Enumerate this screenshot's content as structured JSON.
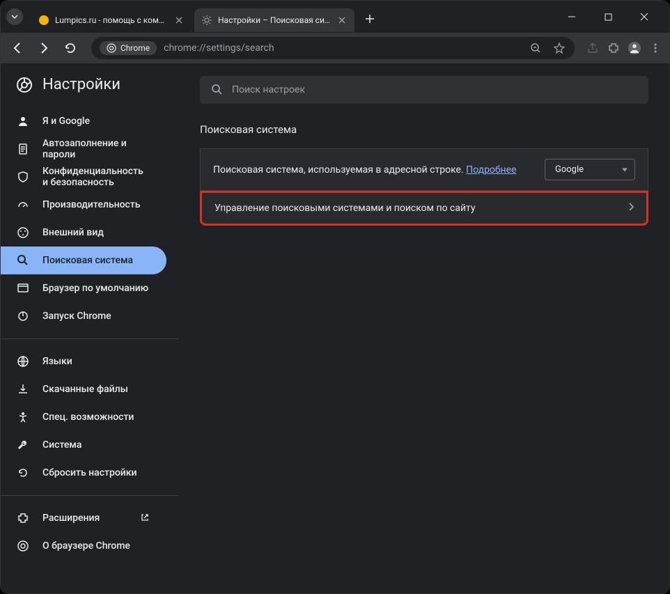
{
  "tabs": [
    {
      "title": "Lumpics.ru - помощь с компью"
    },
    {
      "title": "Настройки – Поисковая систем"
    }
  ],
  "toolbar": {
    "chrome_label": "Chrome",
    "url": "chrome://settings/search"
  },
  "sidebar": {
    "title": "Настройки",
    "items": [
      "Я и Google",
      "Автозаполнение и пароли",
      "Конфиденциальность и безопасность",
      "Производительность",
      "Внешний вид",
      "Поисковая система",
      "Браузер по умолчанию",
      "Запуск Chrome"
    ],
    "items2": [
      "Языки",
      "Скачанные файлы",
      "Спец. возможности",
      "Система",
      "Сбросить настройки"
    ],
    "items3": [
      "Расширения",
      "О браузере Chrome"
    ]
  },
  "main": {
    "search_placeholder": "Поиск настроек",
    "section_title": "Поисковая система",
    "row1_text": "Поисковая система, используемая в адресной строке. ",
    "row1_link": "Подробнее",
    "dropdown_value": "Google",
    "row2_text": "Управление поисковыми системами и поиском по сайту"
  }
}
